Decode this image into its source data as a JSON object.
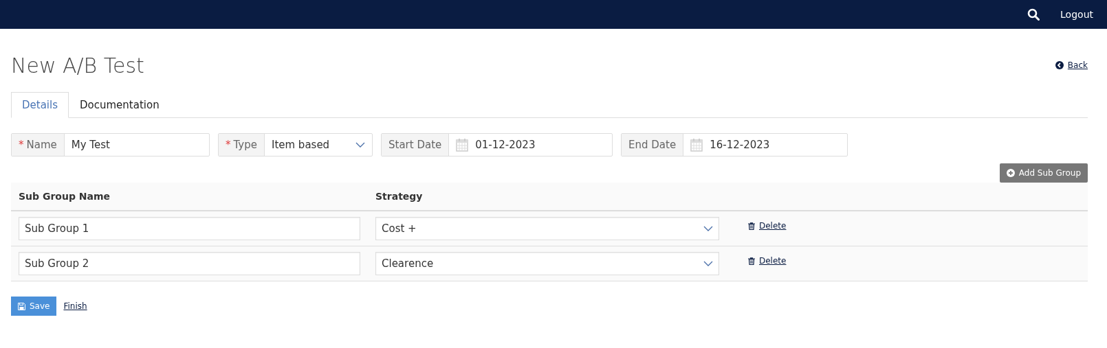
{
  "top_bar": {
    "logout": "Logout"
  },
  "page": {
    "title": "New A/B Test",
    "back": "Back"
  },
  "tabs": [
    {
      "label": "Details",
      "selected": true
    },
    {
      "label": "Documentation",
      "selected": false
    }
  ],
  "fields": [
    {
      "kind": "text",
      "marker": "*",
      "label": "Name",
      "value": "My Test"
    },
    {
      "kind": "select",
      "marker": "*",
      "label": "Type",
      "value": "Item based"
    },
    {
      "kind": "date",
      "label": "Start Date",
      "value": "01-12-2023"
    },
    {
      "kind": "date",
      "label": "End Date",
      "value": "16-12-2023"
    }
  ],
  "add_button": "Add Sub Group",
  "table": {
    "columns": [
      "Sub Group Name",
      "Strategy"
    ],
    "rows": [
      {
        "name": "Sub Group 1",
        "strategy": "Cost +",
        "action": "Delete"
      },
      {
        "name": "Sub Group 2",
        "strategy": "Clearence",
        "action": "Delete"
      }
    ]
  },
  "actions": {
    "save": "Save",
    "finish": "Finish"
  }
}
